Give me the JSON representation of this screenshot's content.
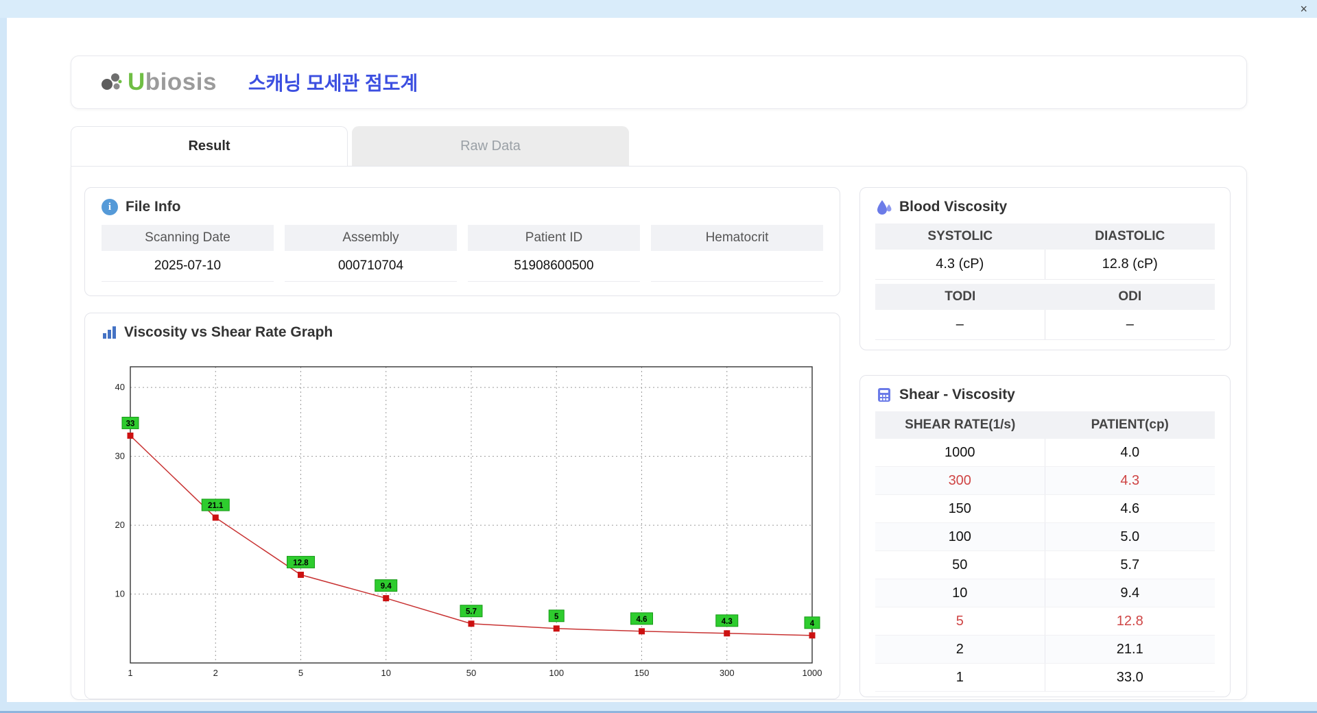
{
  "window": {
    "close_label": "×"
  },
  "header": {
    "logo_text_u": "U",
    "logo_text_rest": "biosis",
    "title": "스캐닝 모세관 점도계"
  },
  "tabs": [
    {
      "label": "Result",
      "active": true
    },
    {
      "label": "Raw Data",
      "active": false
    }
  ],
  "file_info": {
    "title": "File Info",
    "fields": [
      {
        "label": "Scanning Date",
        "value": "2025-07-10"
      },
      {
        "label": "Assembly",
        "value": "000710704"
      },
      {
        "label": "Patient ID",
        "value": "51908600500"
      },
      {
        "label": "Hematocrit",
        "value": ""
      }
    ]
  },
  "blood_viscosity": {
    "title": "Blood Viscosity",
    "pairs": [
      {
        "h1": "SYSTOLIC",
        "h2": "DIASTOLIC",
        "v1": "4.3 (cP)",
        "v2": "12.8 (cP)"
      },
      {
        "h1": "TODI",
        "h2": "ODI",
        "v1": "–",
        "v2": "–"
      }
    ]
  },
  "shear_viscosity": {
    "title": "Shear - Viscosity",
    "columns": [
      "SHEAR RATE(1/s)",
      "PATIENT(cp)"
    ],
    "rows": [
      {
        "rate": "1000",
        "value": "4.0",
        "highlight": false
      },
      {
        "rate": "300",
        "value": "4.3",
        "highlight": true
      },
      {
        "rate": "150",
        "value": "4.6",
        "highlight": false
      },
      {
        "rate": "100",
        "value": "5.0",
        "highlight": false
      },
      {
        "rate": "50",
        "value": "5.7",
        "highlight": false
      },
      {
        "rate": "10",
        "value": "9.4",
        "highlight": false
      },
      {
        "rate": "5",
        "value": "12.8",
        "highlight": true
      },
      {
        "rate": "2",
        "value": "21.1",
        "highlight": false
      },
      {
        "rate": "1",
        "value": "33.0",
        "highlight": false
      }
    ]
  },
  "chart_data": {
    "type": "line",
    "title": "Viscosity vs Shear Rate Graph",
    "categories": [
      "1",
      "2",
      "5",
      "10",
      "50",
      "100",
      "150",
      "300",
      "1000"
    ],
    "values": [
      33,
      21.1,
      12.8,
      9.4,
      5.7,
      5,
      4.6,
      4.3,
      4
    ],
    "point_labels": [
      "33",
      "21.1",
      "12.8",
      "9.4",
      "5.7",
      "5",
      "4.6",
      "4.3",
      "4"
    ],
    "xlabel": "",
    "ylabel": "",
    "ylim": [
      0,
      43
    ],
    "yticks": [
      10,
      20,
      30,
      40
    ],
    "grid": "dotted",
    "legend": "none",
    "line_color": "#c83232",
    "marker_color": "#cc1111",
    "label_bg": "#2ecc2e",
    "label_border": "#159915"
  },
  "colors": {
    "titlebar": "#d9ecfa",
    "accent_blue": "#3c4fe0",
    "highlight_red": "#cf4545",
    "header_gray": "#f1f2f5"
  }
}
